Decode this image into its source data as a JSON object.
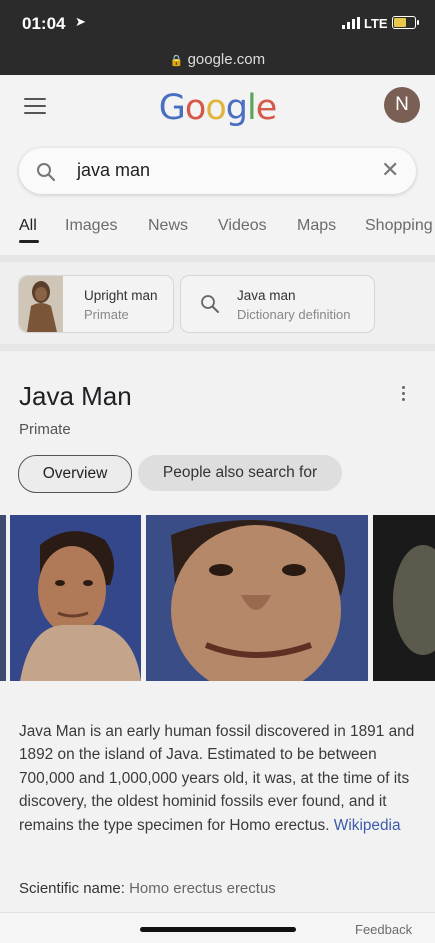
{
  "status_bar": {
    "time": "01:04",
    "carrier": "LTE"
  },
  "browser": {
    "url": "google.com"
  },
  "header": {
    "logo_letters": [
      {
        "ch": "G",
        "color": "#4a6fc2"
      },
      {
        "ch": "o",
        "color": "#d4594a"
      },
      {
        "ch": "o",
        "color": "#e0b43e"
      },
      {
        "ch": "g",
        "color": "#4a6fc2"
      },
      {
        "ch": "l",
        "color": "#5aa35a"
      },
      {
        "ch": "e",
        "color": "#d4594a"
      }
    ],
    "avatar_initial": "N"
  },
  "search": {
    "query": "java man",
    "clear_glyph": "✕"
  },
  "tabs": [
    "All",
    "Images",
    "News",
    "Videos",
    "Maps",
    "Shopping"
  ],
  "chips": [
    {
      "title": "Upright man",
      "subtitle": "Primate"
    },
    {
      "title": "Java man",
      "subtitle": "Dictionary definition"
    }
  ],
  "knowledge_panel": {
    "title": "Java Man",
    "subtitle": "Primate",
    "pills": [
      "Overview",
      "People also search for"
    ],
    "description": "Java Man is an early human fossil discovered in 1891 and 1892 on the island of Java. Estimated to be between 700,000 and 1,000,000 years old, it was, at the time of its discovery, the oldest hominid fossils ever found, and it remains the type specimen for Homo erectus.",
    "source_link": "Wikipedia",
    "scientific_name_label": "Scientific name:",
    "scientific_name_value": "Homo erectus erectus"
  },
  "footer": {
    "feedback": "Feedback"
  }
}
